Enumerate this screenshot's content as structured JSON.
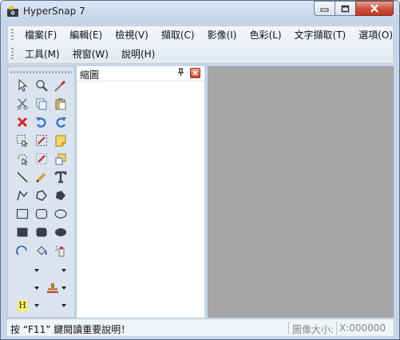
{
  "window": {
    "title": "HyperSnap 7"
  },
  "menu": {
    "row1": [
      "檔案(F)",
      "編輯(E)",
      "檢視(V)",
      "擷取(C)",
      "影像(I)",
      "色彩(L)",
      "文字擷取(T)",
      "選項(O)"
    ],
    "row2": [
      "工具(M)",
      "視窗(W)",
      "說明(H)"
    ]
  },
  "tool_icons": [
    "select-arrow-icon",
    "zoom-icon",
    "eyedropper-icon",
    "cut-icon",
    "copy-icon",
    "paste-icon",
    "delete-icon",
    "undo-icon",
    "redo-icon",
    "crop-select-icon",
    "magic-wand-icon",
    "note-icon",
    "freehand-select-icon",
    "pencil-erase-icon",
    "sticky-icon",
    "line-icon",
    "pencil-icon",
    "text-icon",
    "polyline-icon",
    "polygon-icon",
    "filled-polygon-icon",
    "rectangle-icon",
    "rounded-rectangle-icon",
    "ellipse-icon",
    "filled-rectangle-icon",
    "filled-rounded-rectangle-icon",
    "filled-ellipse-icon",
    "arc-icon",
    "fill-bucket-icon",
    "spray-icon",
    "line-width-dropdown-icon",
    "line-style-dropdown-icon",
    "arrow-style-dropdown-icon",
    "stamp-dropdown-icon",
    "highlight-dropdown-icon",
    "shadow-dropdown-icon"
  ],
  "highlight_label": "H",
  "pane": {
    "title": "縮圖"
  },
  "status": {
    "hint": "按 “F11” 鍵閱讀重要說明！",
    "image_size_label": "圖像大小:",
    "coords": "X:000000"
  },
  "colors": {
    "canvas": "#a5a5a5",
    "frame": "#c6d5e8",
    "close_button": "#c9432f"
  }
}
